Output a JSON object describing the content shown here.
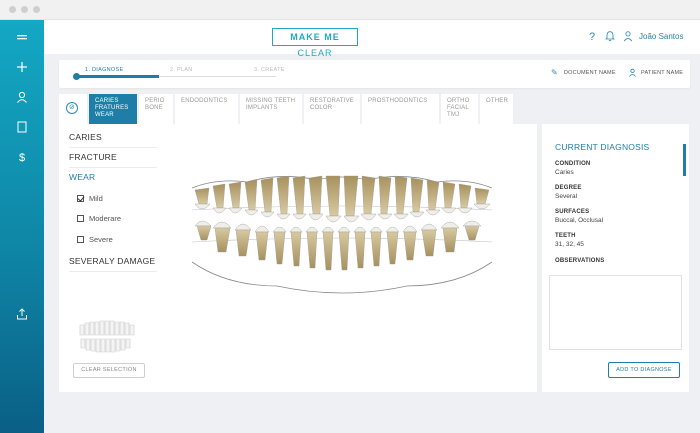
{
  "sidebar": {
    "items": [
      {
        "icon": "menu-icon"
      },
      {
        "icon": "add-icon"
      },
      {
        "icon": "user-icon"
      },
      {
        "icon": "document-icon"
      },
      {
        "icon": "dollar-icon"
      },
      {
        "icon": "upload-icon"
      }
    ]
  },
  "header": {
    "logo_bold": "MAKE ME",
    "logo_light": "CLEAR",
    "help_icon": "?",
    "user_name": "João Santos"
  },
  "steps": {
    "items": [
      {
        "label": "1. DIAGNOSE",
        "active": true
      },
      {
        "label": "2. PLAN",
        "active": false
      },
      {
        "label": "3. CREATE",
        "active": false
      }
    ],
    "document_name": "DOCUMENT NAME",
    "patient_name": "PATIENT NAME"
  },
  "tabs": [
    {
      "line1": "CARIES",
      "line2": "FRATURES",
      "line3": "WEAR",
      "active": true
    },
    {
      "line1": "PERIO",
      "line2": "BONE",
      "line3": ""
    },
    {
      "line1": "ENDODONTICS",
      "line2": "",
      "line3": ""
    },
    {
      "line1": "MISSING TEETH",
      "line2": "IMPLANTS",
      "line3": ""
    },
    {
      "line1": "RESTORATIVE",
      "line2": "COLOR",
      "line3": ""
    },
    {
      "line1": "PROSTHODONTICS",
      "line2": "",
      "line3": ""
    },
    {
      "line1": "ORTHO",
      "line2": "FACIAL",
      "line3": "TMJ"
    },
    {
      "line1": "OTHER",
      "line2": "",
      "line3": ""
    }
  ],
  "categories": {
    "caries": "CARIES",
    "fracture": "FRACTURE",
    "wear": "WEAR",
    "wear_options": [
      {
        "label": "Mild",
        "checked": true
      },
      {
        "label": "Moderare",
        "checked": false
      },
      {
        "label": "Severe",
        "checked": false
      }
    ],
    "severe_damage": "SEVERALY DAMAGE",
    "clear_button": "CLEAR SELECTION"
  },
  "diagnosis": {
    "title": "CURRENT DIAGNOSIS",
    "condition_label": "CONDITION",
    "condition_value": "Caries",
    "degree_label": "DEGREE",
    "degree_value": "Several",
    "surfaces_label": "SURFACES",
    "surfaces_value": "Buccal, Occlusal",
    "teeth_label": "TEETH",
    "teeth_value": "31, 32, 45",
    "observations_label": "OBSERVATIONS",
    "add_button": "ADD TO DIAGNOSE"
  },
  "colors": {
    "accent": "#1f7ea8",
    "sidebar_top": "#13a8c4",
    "sidebar_bottom": "#0a5f86",
    "background": "#eef0f3"
  }
}
